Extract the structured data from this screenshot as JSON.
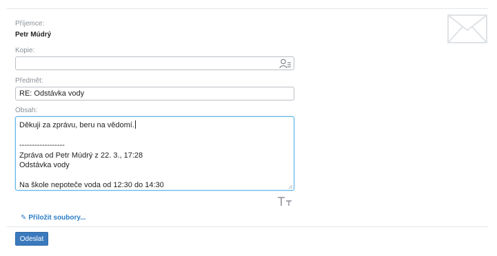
{
  "recipient": {
    "label": "Příjemce:",
    "name": "Petr Múdrý"
  },
  "copy": {
    "label": "Kopie:",
    "value": "",
    "icon": "contacts-icon"
  },
  "subject": {
    "label": "Předmět:",
    "value": "RE: Odstávka vody"
  },
  "body": {
    "label": "Obsah:",
    "lines": [
      "Děkuji za zprávu, beru na vědomí.",
      "",
      "------------------",
      "Zpráva od Petr Múdrý z 22. 3., 17:28",
      "Odstávka vody",
      "",
      "Na škole nepoteče voda od 12:30 do 14:30"
    ],
    "text_size_icon": "text-size-icon"
  },
  "attach": {
    "label": "Přiložit soubory...",
    "icon": "paperclip-icon"
  },
  "send": {
    "label": "Odeslat"
  },
  "decoration": {
    "icon": "envelope-icon"
  },
  "colors": {
    "accent": "#3b79bd",
    "link": "#2a7cc7",
    "focus_border": "#5bb4e8",
    "label": "#8a8f95"
  }
}
